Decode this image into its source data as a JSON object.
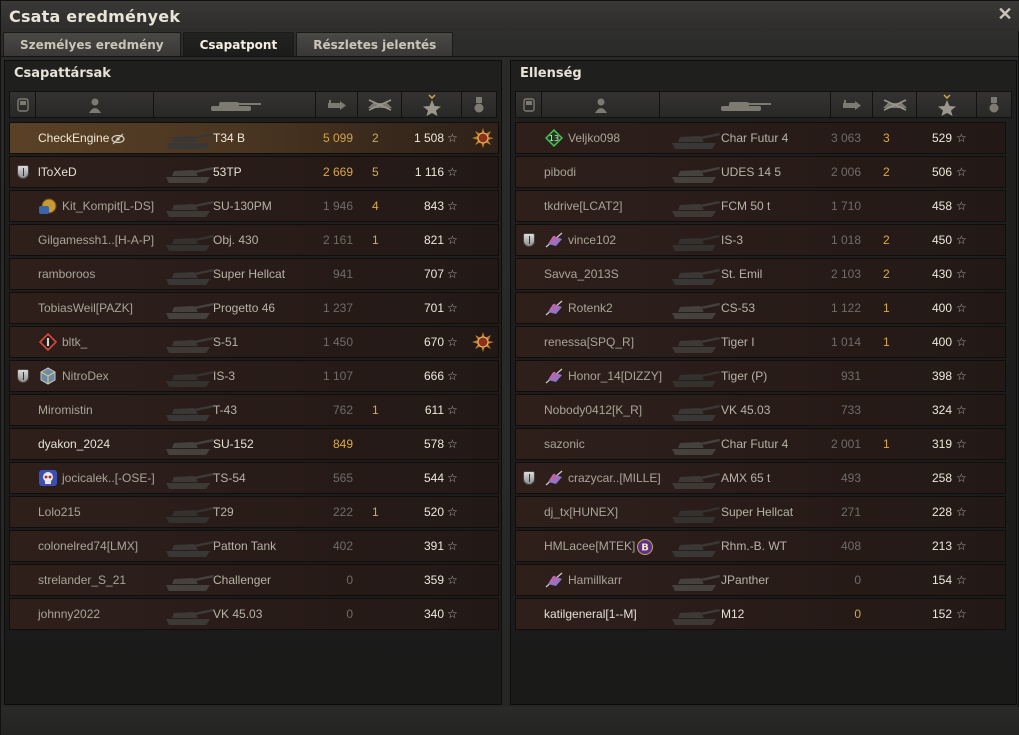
{
  "window": {
    "title": "Csata eredmények",
    "close_icon": "close-icon"
  },
  "tabs": [
    {
      "label": "Személyes eredmény",
      "active": false
    },
    {
      "label": "Csapatpont",
      "active": true
    },
    {
      "label": "Részletes jelentés",
      "active": false
    }
  ],
  "columns": [
    "squad-icon",
    "player-icon",
    "tank-icon",
    "damage-icon",
    "kills-icon",
    "xp-star-icon",
    "medal-icon"
  ],
  "colors": {
    "accent": "#d7aa4e",
    "my_row": "#5a4126",
    "row": "#2e1f1b"
  },
  "allies": {
    "title": "Csapattársak",
    "players": [
      {
        "name": "CheckEngine",
        "tank": "T34 B",
        "damage": "5 099",
        "kills": "2",
        "xp": "1 508",
        "me": true,
        "medal": "medal-sun-icon",
        "badge": "",
        "clan": "",
        "extra_icon": "eye-hidden-icon"
      },
      {
        "name": "lToXeD",
        "tank": "53TP",
        "damage": "2 669",
        "kills": "5",
        "xp": "1 116",
        "hl": true,
        "badge": "platoon-shield-icon",
        "clan": ""
      },
      {
        "name": "Kit_Kompit[L-DS]",
        "tank": "SU-130PM",
        "damage": "1 946",
        "kills": "4",
        "xp": "843",
        "clan": "gold-clan-icon"
      },
      {
        "name": "Gilgamessh1..[H-A-P]",
        "tank": "Obj. 430",
        "damage": "2 161",
        "kills": "1",
        "xp": "821"
      },
      {
        "name": "ramboroos",
        "tank": "Super Hellcat",
        "damage": "941",
        "kills": "",
        "xp": "707"
      },
      {
        "name": "TobiasWeil[PAZK]",
        "tank": "Progetto 46",
        "damage": "1 237",
        "kills": "",
        "xp": "701"
      },
      {
        "name": "bltk_",
        "tank": "S-51",
        "damage": "1 450",
        "kills": "",
        "xp": "670",
        "medal": "medal-sun-icon",
        "clan": "red-diamond-clan-icon"
      },
      {
        "name": "NitroDex",
        "tank": "IS-3",
        "damage": "1 107",
        "kills": "",
        "xp": "666",
        "badge": "platoon-shield-icon",
        "clan": "cube-clan-icon"
      },
      {
        "name": "Miromistin",
        "tank": "T-43",
        "damage": "762",
        "kills": "1",
        "xp": "611"
      },
      {
        "name": "dyakon_2024",
        "tank": "SU-152",
        "damage": "849",
        "kills": "",
        "xp": "578",
        "hl": true
      },
      {
        "name": "jocicalek..[-OSE-]",
        "tank": "TS-54",
        "damage": "565",
        "kills": "",
        "xp": "544",
        "clan": "skull-clan-icon"
      },
      {
        "name": "Lolo215",
        "tank": "T29",
        "damage": "222",
        "kills": "1",
        "xp": "520"
      },
      {
        "name": "colonelred74[LMX]",
        "tank": "Patton Tank",
        "damage": "402",
        "kills": "",
        "xp": "391"
      },
      {
        "name": "strelander_S_21",
        "tank": "Challenger",
        "damage": "0",
        "kills": "",
        "xp": "359"
      },
      {
        "name": "johnny2022",
        "tank": "VK 45.03",
        "damage": "0",
        "kills": "",
        "xp": "340"
      }
    ]
  },
  "enemies": {
    "title": "Ellenség",
    "players": [
      {
        "name": "Veljko098",
        "tank": "Char Futur 4",
        "damage": "3 063",
        "kills": "3",
        "xp": "529",
        "clan": "green-badge-13-icon",
        "clan_text": "13"
      },
      {
        "name": "pibodi",
        "tank": "UDES 14 5",
        "damage": "2 006",
        "kills": "2",
        "xp": "506"
      },
      {
        "name": "tkdrive[LCAT2]",
        "tank": "FCM 50 t",
        "damage": "1 710",
        "kills": "",
        "xp": "458"
      },
      {
        "name": "vince102",
        "tank": "IS-3",
        "damage": "1 018",
        "kills": "2",
        "xp": "450",
        "badge": "platoon-shield-icon",
        "clan": "flag-clan-icon"
      },
      {
        "name": "Savva_2013S",
        "tank": "St. Emil",
        "damage": "2 103",
        "kills": "2",
        "xp": "430"
      },
      {
        "name": "Rotenk2",
        "tank": "CS-53",
        "damage": "1 122",
        "kills": "1",
        "xp": "400",
        "clan": "flag-clan-icon"
      },
      {
        "name": "renessa[SPQ_R]",
        "tank": "Tiger I",
        "damage": "1 014",
        "kills": "1",
        "xp": "400"
      },
      {
        "name": "Honor_14[DIZZY]",
        "tank": "Tiger (P)",
        "damage": "931",
        "kills": "",
        "xp": "398",
        "clan": "flag-clan-icon"
      },
      {
        "name": "Nobody0412[K_R]",
        "tank": "VK 45.03",
        "damage": "733",
        "kills": "",
        "xp": "324"
      },
      {
        "name": "sazonic",
        "tank": "Char Futur 4",
        "damage": "2 001",
        "kills": "1",
        "xp": "319"
      },
      {
        "name": "crazycar..[MILLE]",
        "tank": "AMX 65 t",
        "damage": "493",
        "kills": "",
        "xp": "258",
        "badge": "platoon-shield-icon",
        "clan": "flag-clan-icon"
      },
      {
        "name": "dj_tx[HUNEX]",
        "tank": "Super Hellcat",
        "damage": "271",
        "kills": "",
        "xp": "228"
      },
      {
        "name": "HMLacee[MTEK]",
        "tank": "Rhm.-B. WT",
        "damage": "408",
        "kills": "",
        "xp": "213",
        "extra_icon": "purple-b-badge-icon",
        "extra_text": "B"
      },
      {
        "name": "Hamillkarr",
        "tank": "JPanther",
        "damage": "0",
        "kills": "",
        "xp": "154",
        "clan": "flag-clan-icon"
      },
      {
        "name": "katilgeneral[1--M]",
        "tank": "M12",
        "damage": "0",
        "kills": "",
        "xp": "152",
        "hl": true
      }
    ]
  }
}
